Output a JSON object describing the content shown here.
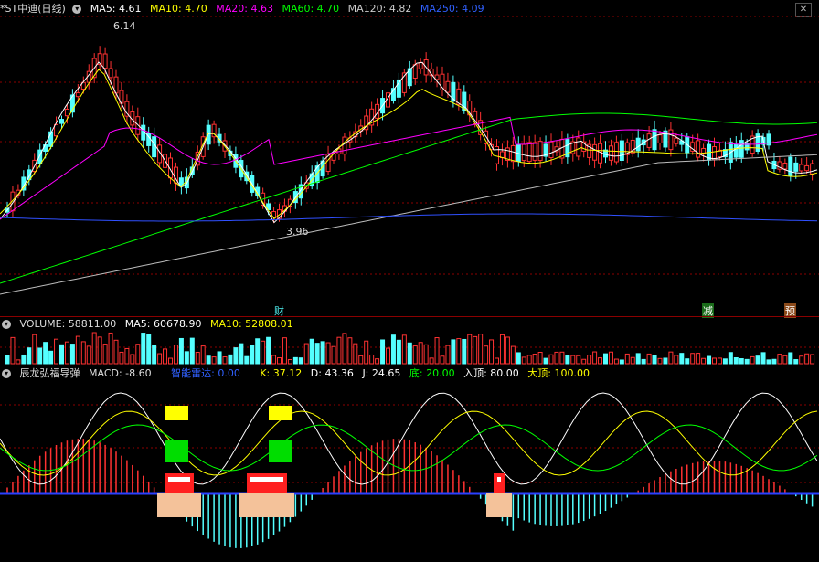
{
  "main_header": {
    "title": "*ST中迪(日线)",
    "ma5": "MA5: 4.61",
    "ma10": "MA10: 4.70",
    "ma20": "MA20: 4.63",
    "ma60": "MA60: 4.70",
    "ma120": "MA120: 4.82",
    "ma250": "MA250: 4.09"
  },
  "price_marks": {
    "high": "6.14",
    "low": "3.96"
  },
  "event_markers": {
    "cai": "财",
    "jian": "减",
    "yu": "预"
  },
  "volume_header": {
    "title": "VOLUME: 58811.00",
    "ma5": "MA5: 60678.90",
    "ma10": "MA10: 52808.01"
  },
  "indicator_header": {
    "title": "辰龙弘福导弹",
    "macd": "MACD: -8.60",
    "radar": "智能雷达: 0.00",
    "k": "K: 37.12",
    "d": "D: 43.36",
    "j": "J: 24.65",
    "di": "底: 20.00",
    "rudi": "入顶: 80.00",
    "dading": "大顶: 100.00"
  },
  "colors": {
    "up": "#ff3232",
    "down": "#54ffff",
    "ma5": "#ffffff",
    "ma10": "#ffff00",
    "ma20": "#ff00ff",
    "ma60": "#00ff00",
    "ma120": "#bbbbbb",
    "ma250": "#3050ff",
    "grid": "#8b0000"
  }
}
